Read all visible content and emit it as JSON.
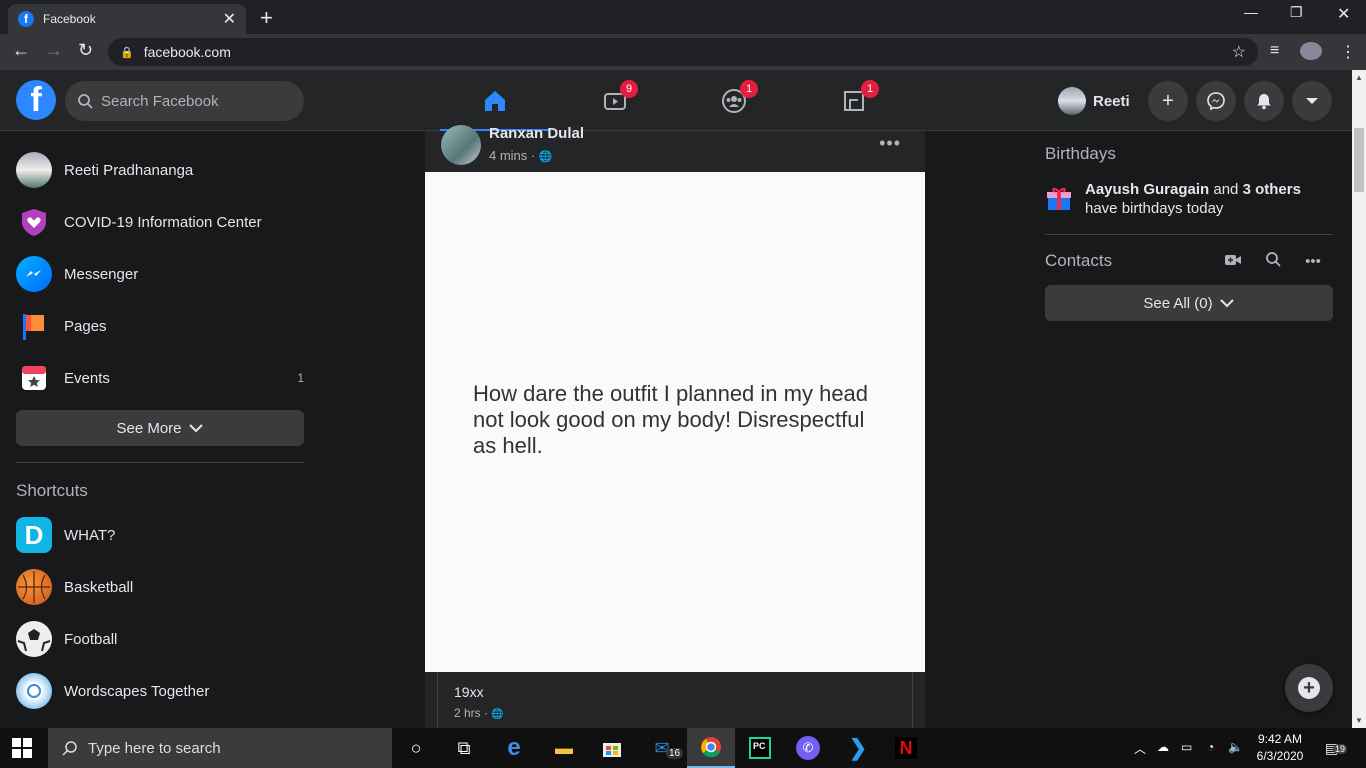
{
  "browser": {
    "tab_title": "Facebook",
    "tab_favicon": "f",
    "url": "facebook.com"
  },
  "header": {
    "logo": "f",
    "search_placeholder": "Search Facebook",
    "nav": [
      {
        "name": "home",
        "badge": ""
      },
      {
        "name": "watch",
        "badge": "9"
      },
      {
        "name": "groups",
        "badge": "1"
      },
      {
        "name": "gaming",
        "badge": "1"
      }
    ],
    "profile_name": "Reeti",
    "accent": "#2d88ff"
  },
  "sidebar": {
    "items": [
      {
        "label": "Reeti Pradhananga",
        "icon": "avatar",
        "count": ""
      },
      {
        "label": "COVID-19 Information Center",
        "icon": "heart-shield-icon",
        "count": ""
      },
      {
        "label": "Messenger",
        "icon": "messenger-icon",
        "count": ""
      },
      {
        "label": "Pages",
        "icon": "flag-icon",
        "count": ""
      },
      {
        "label": "Events",
        "icon": "calendar-star-icon",
        "count": "1"
      }
    ],
    "see_more": "See More",
    "shortcuts_title": "Shortcuts",
    "shortcuts": [
      {
        "label": "WHAT?",
        "icon": "d-app-icon"
      },
      {
        "label": "Basketball",
        "icon": "basketball-icon"
      },
      {
        "label": "Football",
        "icon": "football-icon"
      },
      {
        "label": "Wordscapes Together",
        "icon": "wordscapes-icon"
      }
    ]
  },
  "post": {
    "author": "Ranxan Dulal",
    "time": "4 mins · ",
    "image_text": "How dare the outfit I planned in my head not look good on my body! Disrespectful as hell.",
    "shared_author": "19xx",
    "shared_time": "2 hrs · "
  },
  "right": {
    "birthdays_title": "Birthdays",
    "birthday_name": "Aayush Guragain",
    "birthday_and": " and ",
    "birthday_others": "3 others",
    "birthday_rest": " have birthdays today",
    "contacts_title": "Contacts",
    "see_all": "See All (0)"
  },
  "taskbar": {
    "search_placeholder": "Type here to search",
    "mail_badge": "16",
    "time": "9:42 AM",
    "date": "6/3/2020",
    "notif_count": "19"
  }
}
